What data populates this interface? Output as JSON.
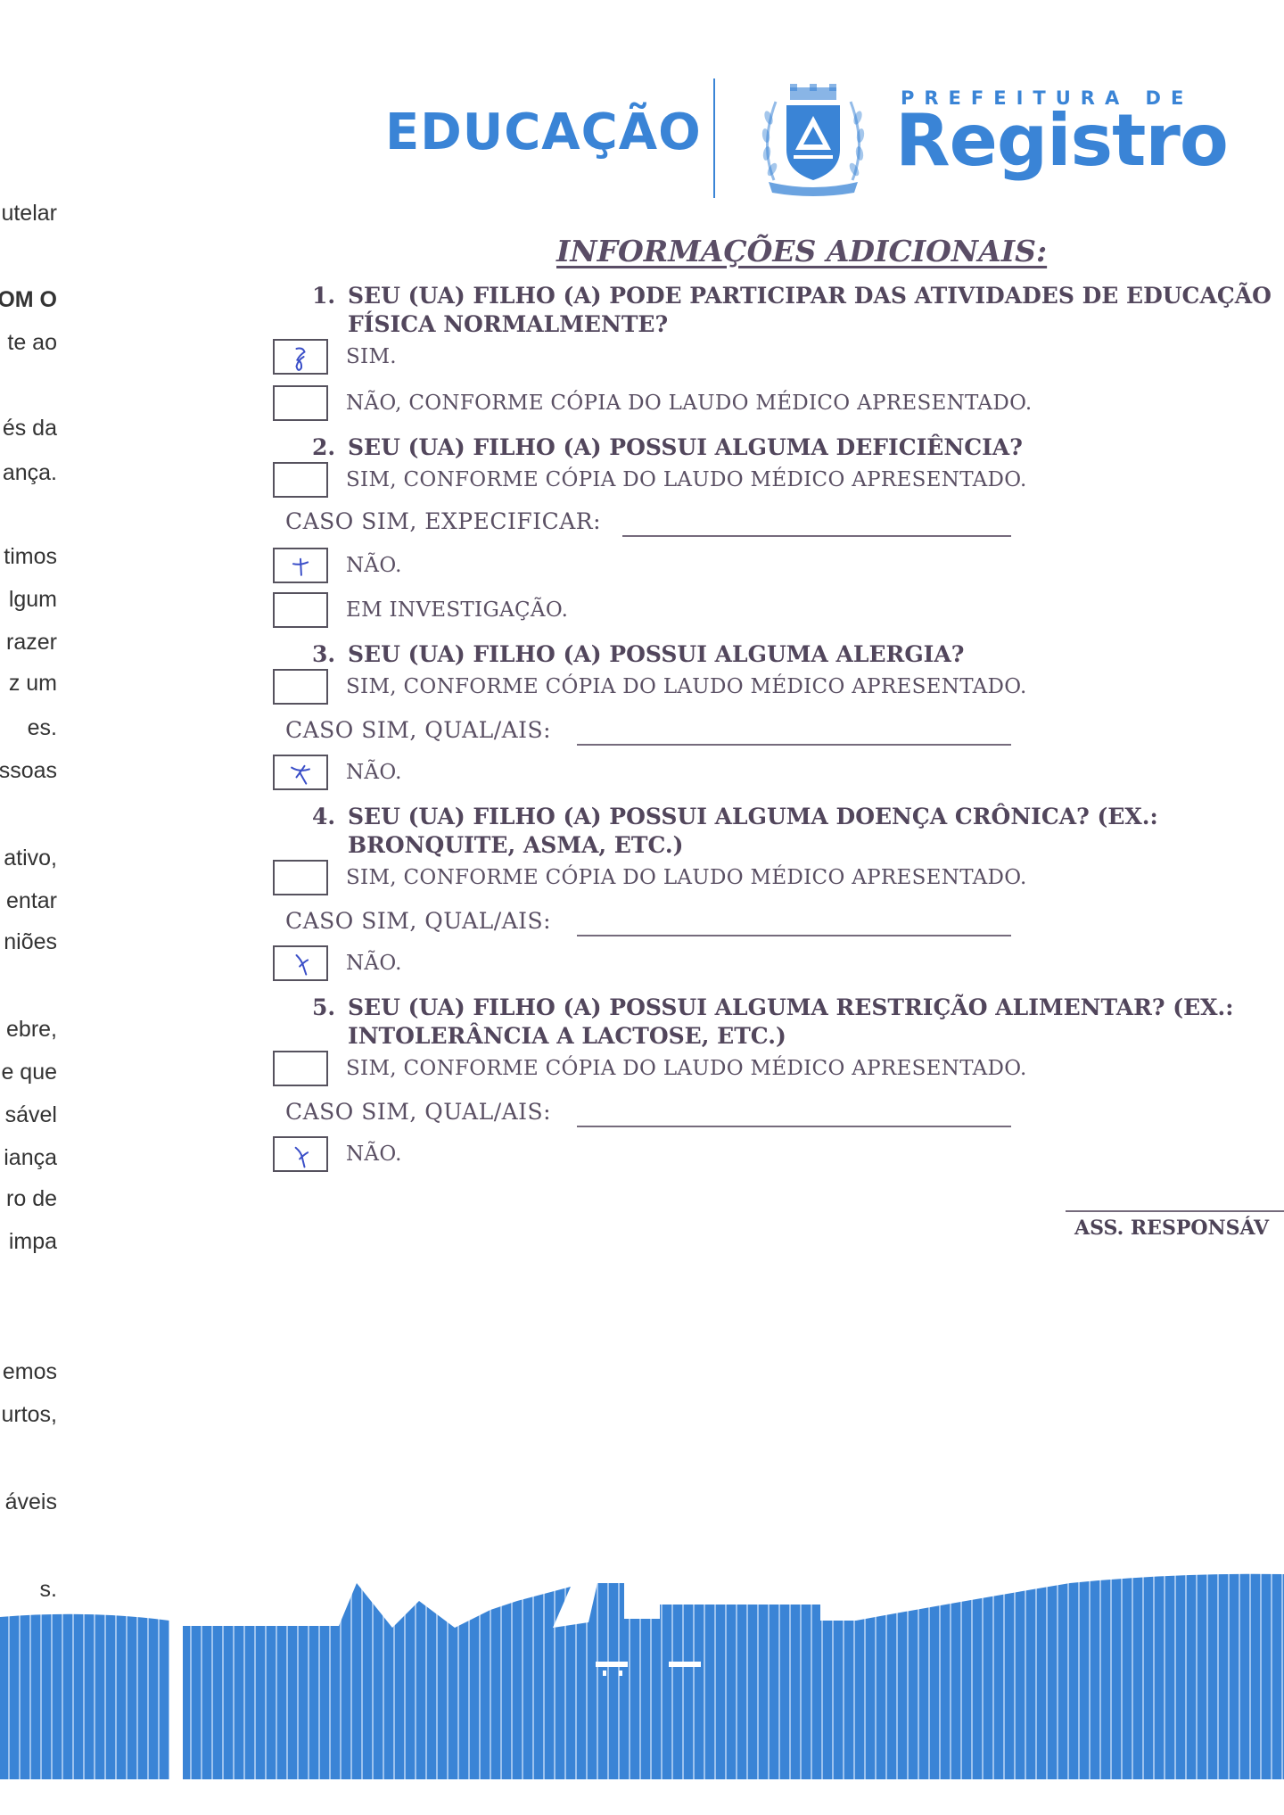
{
  "left_fragments": [
    {
      "text": "utelar",
      "bold": false
    },
    {
      "text": "OM O",
      "bold": true
    },
    {
      "text": "te ao",
      "bold": false
    },
    {
      "text": "és da",
      "bold": false
    },
    {
      "text": "ança.",
      "bold": false
    },
    {
      "text": "timos",
      "bold": false
    },
    {
      "text": "lgum",
      "bold": false
    },
    {
      "text": "razer",
      "bold": false
    },
    {
      "text": "z um",
      "bold": false
    },
    {
      "text": "es.",
      "bold": false
    },
    {
      "text": "ssoas",
      "bold": false
    },
    {
      "text": "ativo,",
      "bold": false
    },
    {
      "text": "entar",
      "bold": false
    },
    {
      "text": "niões",
      "bold": false
    },
    {
      "text": "ebre,",
      "bold": false
    },
    {
      "text": "e que",
      "bold": false
    },
    {
      "text": "sável",
      "bold": false
    },
    {
      "text": "iança",
      "bold": false
    },
    {
      "text": "ro de",
      "bold": false
    },
    {
      "text": "impa",
      "bold": false
    },
    {
      "text": "emos",
      "bold": false
    },
    {
      "text": "urtos,",
      "bold": false
    },
    {
      "text": "áveis",
      "bold": false
    },
    {
      "text": "s.",
      "bold": false
    }
  ],
  "header": {
    "education": "EDUCAÇÃO",
    "prefeitura": "PREFEITURA DE",
    "city": "Registro"
  },
  "colors": {
    "brand_blue": "#3a84d6",
    "text": "#4a3d52",
    "pen_mark": "#3b4fc8"
  },
  "form": {
    "title": "INFORMAÇÕES ADICIONAIS:",
    "questions": [
      {
        "num": "1.",
        "line1": "SEU (UA) FILHO (A) PODE PARTICIPAR DAS ATIVIDADES DE EDUCAÇÃO",
        "line2": "FÍSICA NORMALMENTE?"
      },
      {
        "num": "2.",
        "line1": "SEU (UA) FILHO (A) POSSUI ALGUMA DEFICIÊNCIA?",
        "line2": ""
      },
      {
        "num": "3.",
        "line1": "SEU (UA) FILHO (A) POSSUI ALGUMA ALERGIA?",
        "line2": ""
      },
      {
        "num": "4.",
        "line1": "SEU (UA) FILHO (A) POSSUI ALGUMA DOENÇA CRÔNICA? (EX.:",
        "line2": "BRONQUITE, ASMA, ETC.)"
      },
      {
        "num": "5.",
        "line1": "SEU (UA) FILHO (A) POSSUI ALGUMA RESTRIÇÃO ALIMENTAR? (EX.:",
        "line2": "INTOLERÂNCIA A LACTOSE, ETC.)"
      }
    ],
    "q1_yes": "SIM.",
    "q1_no": "NÃO, CONFORME CÓPIA DO LAUDO MÉDICO APRESENTADO.",
    "sim_laudo": "SIM, CONFORME CÓPIA DO LAUDO MÉDICO APRESENTADO.",
    "nao": "NÃO.",
    "caso_especificar": "CASO SIM, EXPECIFICAR:",
    "caso_qual": "CASO SIM, QUAL/AIS:",
    "em_investigacao": "EM INVESTIGAÇÃO.",
    "checked": {
      "q1_sim": true,
      "q1_nao": false,
      "q2_sim": false,
      "q2_nao": true,
      "q2_investigacao": false,
      "q3_sim": false,
      "q3_nao": true,
      "q4_sim": false,
      "q4_nao": true,
      "q5_sim": false,
      "q5_nao": true
    },
    "signature_label": "ASS. RESPONSÁV"
  }
}
